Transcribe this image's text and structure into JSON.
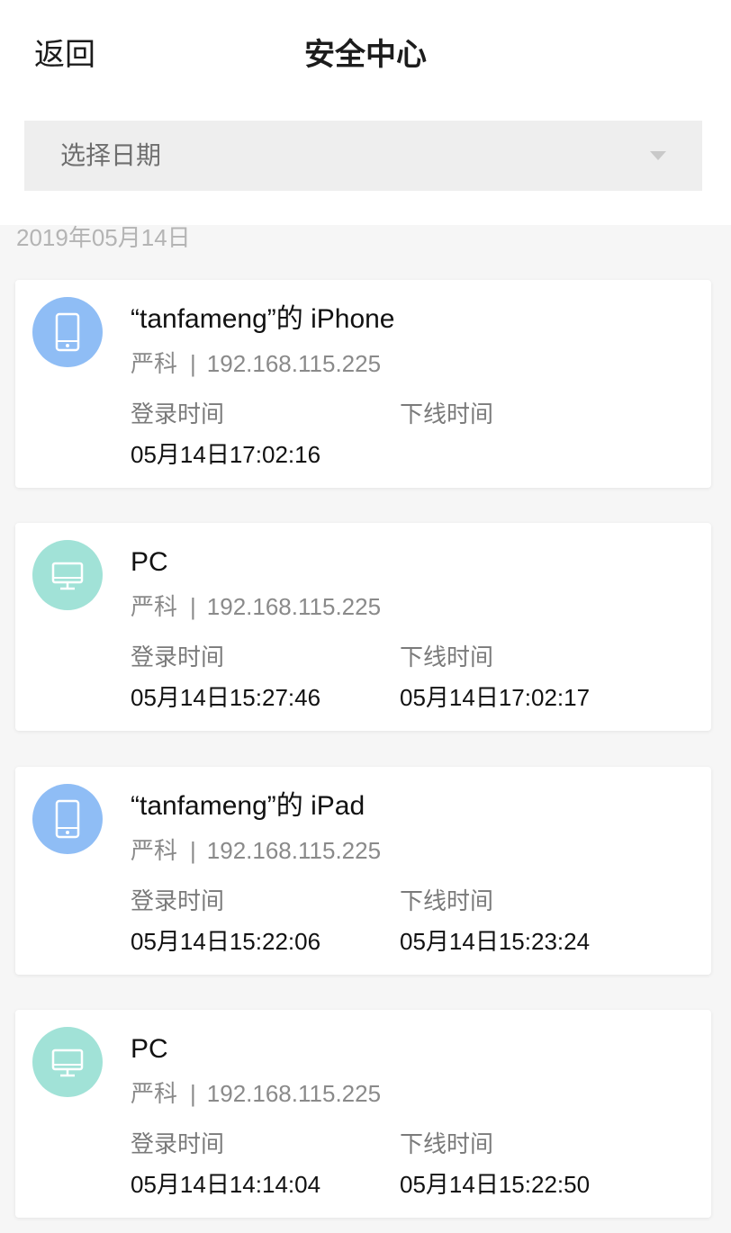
{
  "header": {
    "back_label": "返回",
    "title": "安全中心"
  },
  "date_filter": {
    "label": "选择日期"
  },
  "section": {
    "date": "2019年05月14日"
  },
  "labels": {
    "login": "登录时间",
    "logout": "下线时间"
  },
  "colors": {
    "phone_avatar": "#8fbdf5",
    "pc_avatar": "#a1e2d7"
  },
  "sessions": [
    {
      "icon": "phone-icon",
      "device": "“tanfameng”的 iPhone",
      "user": "严科",
      "separator": "|",
      "ip": "192.168.115.225",
      "login_time": "05月14日17:02:16",
      "logout_time": ""
    },
    {
      "icon": "monitor-icon",
      "device": "PC",
      "user": "严科",
      "separator": "|",
      "ip": "192.168.115.225",
      "login_time": "05月14日15:27:46",
      "logout_time": "05月14日17:02:17"
    },
    {
      "icon": "phone-icon",
      "device": "“tanfameng”的 iPad",
      "user": "严科",
      "separator": "|",
      "ip": "192.168.115.225",
      "login_time": "05月14日15:22:06",
      "logout_time": "05月14日15:23:24"
    },
    {
      "icon": "monitor-icon",
      "device": "PC",
      "user": "严科",
      "separator": "|",
      "ip": "192.168.115.225",
      "login_time": "05月14日14:14:04",
      "logout_time": "05月14日15:22:50"
    }
  ]
}
